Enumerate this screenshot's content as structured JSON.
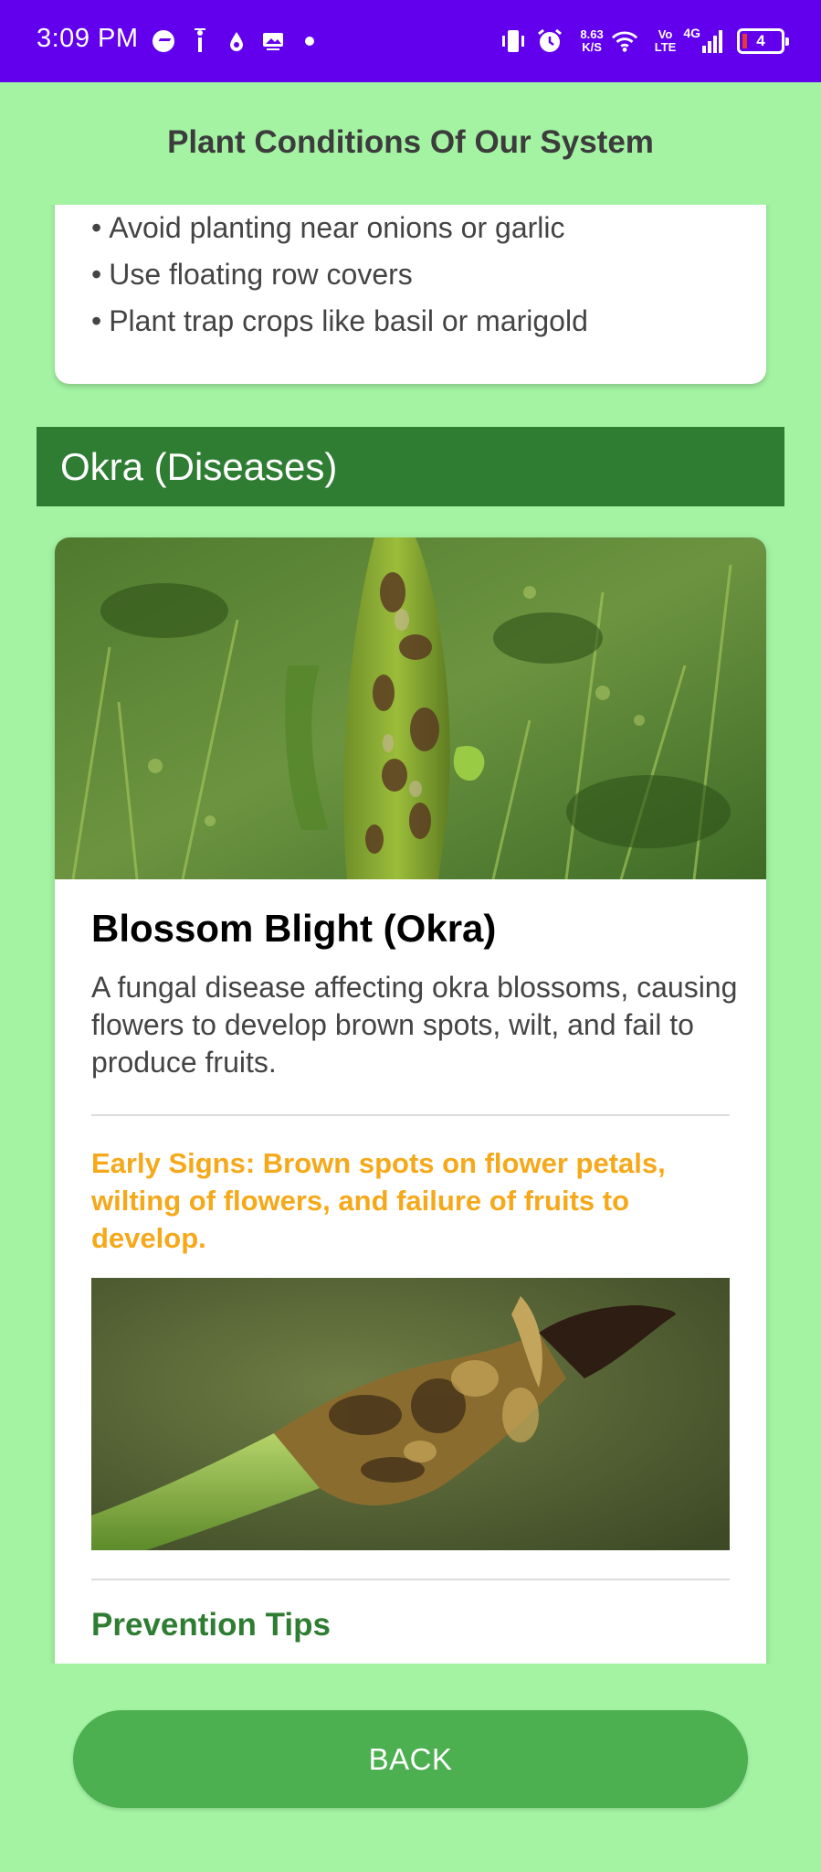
{
  "status_bar": {
    "time": "3:09 PM",
    "net_speed_value": "8.63",
    "net_speed_unit": "K/S",
    "volte_top": "Vo",
    "volte_bottom": "LTE",
    "network_type": "4G",
    "battery_level": "4",
    "icons": [
      "messenger-icon",
      "info-icon",
      "drop-icon",
      "gallery-icon",
      "dot-icon",
      "vibrate-icon",
      "alarm-icon",
      "wifi-icon",
      "signal-icon",
      "battery-icon"
    ]
  },
  "header": {
    "title": "Plant Conditions Of Our System"
  },
  "previous_card": {
    "bullets": [
      "Avoid planting near onions or garlic",
      "Use floating row covers",
      "Plant trap crops like basil or marigold"
    ],
    "bullet_symbol": "•"
  },
  "section": {
    "title": "Okra (Diseases)"
  },
  "disease": {
    "title": "Blossom Blight (Okra)",
    "description": "A fungal disease affecting okra blossoms, causing flowers to develop brown spots, wilt, and fail to produce fruits.",
    "early_signs": "Early Signs: Brown spots on flower petals, wilting of flowers, and failure of fruits to develop.",
    "prevention_title": "Prevention Tips"
  },
  "footer": {
    "back_label": "BACK"
  },
  "colors": {
    "status_bar": "#6200ee",
    "background": "#a3f3a3",
    "section_header": "#2e7d32",
    "early_signs": "#f5a91a",
    "back_button": "#4caf50"
  }
}
